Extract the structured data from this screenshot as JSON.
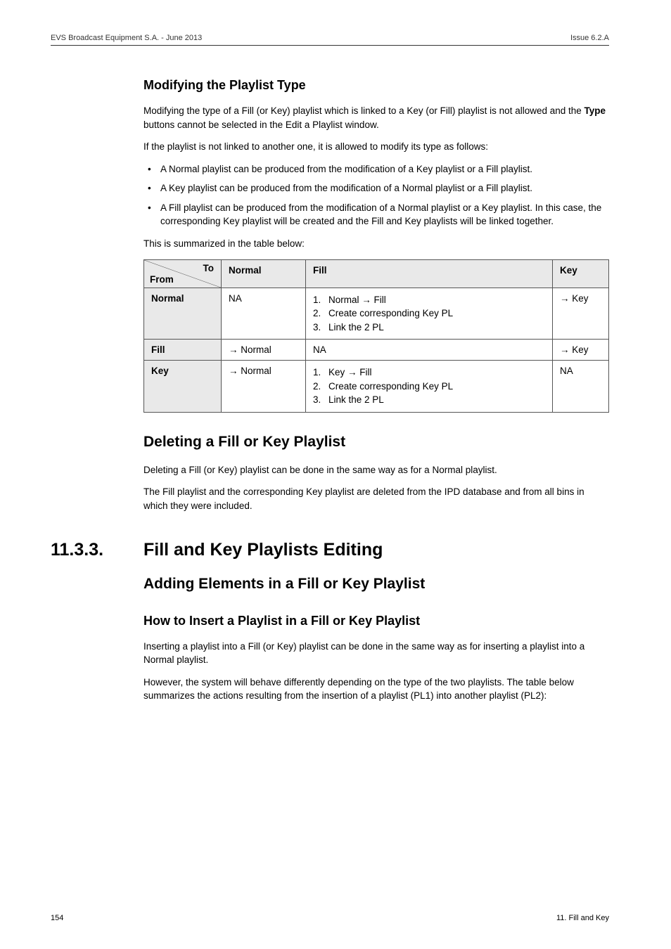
{
  "header": {
    "left": "EVS Broadcast Equipment S.A. - June 2013",
    "right": "Issue 6.2.A"
  },
  "sec1": {
    "title": "Modifying the Playlist Type",
    "p1a": "Modifying the type of a Fill (or Key) playlist which is linked to a Key (or Fill) playlist is not allowed and the ",
    "p1b": "Type",
    "p1c": " buttons cannot be selected in the Edit a Playlist window.",
    "p2": "If the playlist is not linked to another one, it is allowed to modify its type as follows:",
    "bullets": [
      "A Normal playlist can be produced from the modification of a Key playlist or a Fill playlist.",
      "A Key playlist can be produced from the modification of a Normal playlist or a Fill playlist.",
      "A Fill playlist can be produced from the modification of a Normal playlist or a Key playlist. In this case, the corresponding Key playlist will be created and the Fill and Key playlists will be linked together."
    ],
    "p3": "This is summarized in the table below:"
  },
  "table": {
    "head": {
      "to": "To",
      "from": "From",
      "c2": "Normal",
      "c3": "Fill",
      "c4": "Key"
    },
    "rows": [
      {
        "label": "Normal",
        "normal": "NA",
        "fill_steps": [
          "Normal → Fill",
          "Create corresponding Key PL",
          "Link the 2 PL"
        ],
        "key": "→ Key"
      },
      {
        "label": "Fill",
        "normal": "→ Normal",
        "fill_text": "NA",
        "key": "→ Key"
      },
      {
        "label": "Key",
        "normal": "→ Normal",
        "fill_steps": [
          "Key → Fill",
          "Create corresponding Key PL",
          "Link the 2 PL"
        ],
        "key": "NA"
      }
    ]
  },
  "sec2": {
    "title": "Deleting a Fill or Key Playlist",
    "p1": "Deleting a Fill (or Key) playlist can be done in the same way as for a Normal playlist.",
    "p2": "The Fill playlist and the corresponding Key playlist are deleted from the IPD database and from all bins in which they were included."
  },
  "sec3": {
    "num": "11.3.3.",
    "title": "Fill and Key Playlists Editing",
    "sub1": "Adding Elements in a Fill or Key Playlist",
    "sub2": "How to Insert a Playlist in a Fill or Key Playlist",
    "p1": "Inserting a playlist into a Fill (or Key) playlist can be done in the same way as for inserting a playlist into a Normal playlist.",
    "p2": "However, the system will behave differently depending on the type of the two playlists. The table below summarizes the actions resulting from the insertion of a playlist (PL1) into another playlist (PL2):"
  },
  "footer": {
    "left": "154",
    "right": "11. Fill and Key"
  }
}
